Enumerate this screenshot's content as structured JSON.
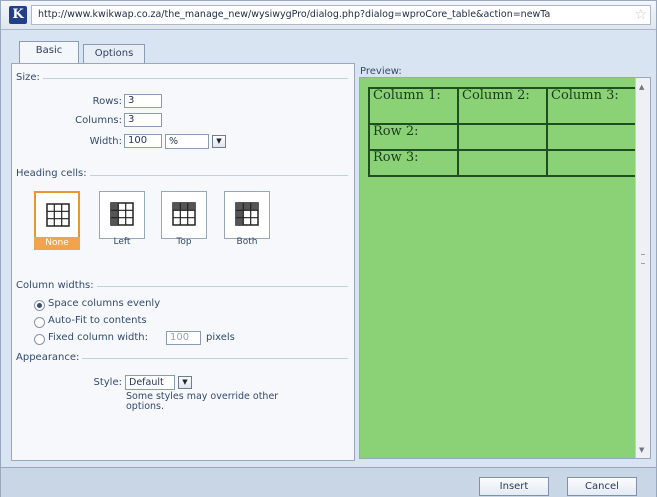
{
  "window": {
    "url": "http://www.kwikwap.co.za/the_manage_new/wysiwygPro/dialog.php?dialog=wproCore_table&action=newTa"
  },
  "tabs": [
    {
      "label": "Basic"
    },
    {
      "label": "Options"
    }
  ],
  "size": {
    "legend": "Size:",
    "rows_label": "Rows:",
    "rows_value": "3",
    "columns_label": "Columns:",
    "columns_value": "3",
    "width_label": "Width:",
    "width_value": "100",
    "width_unit": "%"
  },
  "heading_cells": {
    "legend": "Heading cells:",
    "options": [
      {
        "label": "None"
      },
      {
        "label": "Left"
      },
      {
        "label": "Top"
      },
      {
        "label": "Both"
      }
    ],
    "selected": "None"
  },
  "column_widths": {
    "legend": "Column widths:",
    "space_evenly": "Space columns evenly",
    "auto_fit": "Auto-Fit to contents",
    "fixed_label": "Fixed column width:",
    "fixed_value": "100",
    "fixed_unit": "pixels"
  },
  "appearance": {
    "legend": "Appearance:",
    "style_label": "Style:",
    "style_value": "Default",
    "note": "Some styles may override other options."
  },
  "preview": {
    "label": "Preview:",
    "rows": [
      [
        "Column 1:",
        "Column 2:",
        "Column 3:"
      ],
      [
        "Row 2:",
        "",
        ""
      ],
      [
        "Row 3:",
        "",
        ""
      ]
    ]
  },
  "footer": {
    "insert": "Insert",
    "cancel": "Cancel"
  },
  "colors": {
    "preview_bg": "#8ad275",
    "selected_accent": "#e8972e"
  },
  "icons": {
    "app": "wysiwygpro-icon",
    "favorite": "star-icon",
    "dropdown": "arrow-down-icon"
  }
}
